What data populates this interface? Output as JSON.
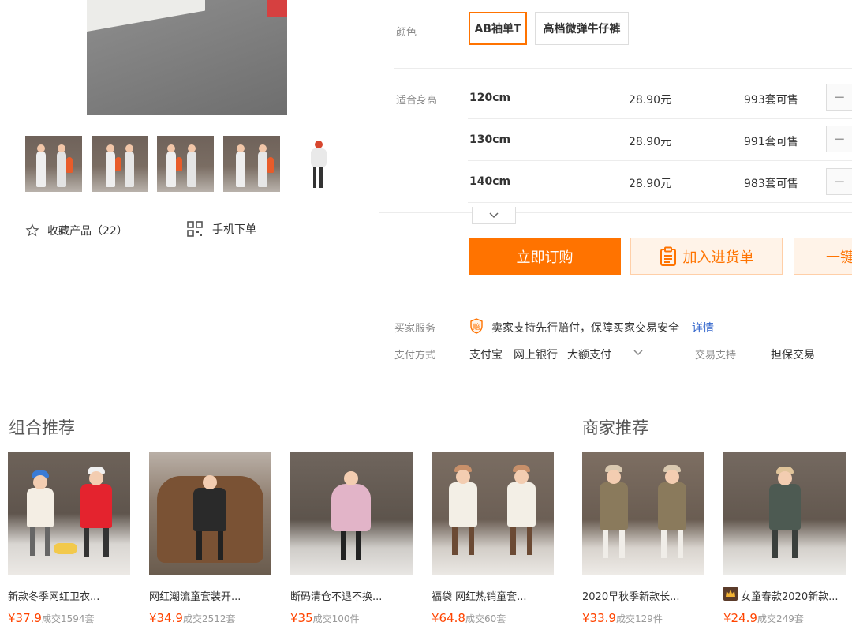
{
  "gallery": {
    "favorite_label": "收藏产品（22）",
    "mobile_order_label": "手机下单"
  },
  "spec": {
    "color_label": "颜色",
    "color_options": [
      "AB袖单T",
      "高档微弹牛仔裤"
    ],
    "selected_color": "AB袖单T",
    "height_label": "适合身高",
    "rows": [
      {
        "size": "120cm",
        "price": "28.90元",
        "stock": "993套可售"
      },
      {
        "size": "130cm",
        "price": "28.90元",
        "stock": "991套可售"
      },
      {
        "size": "140cm",
        "price": "28.90元",
        "stock": "983套可售"
      }
    ],
    "minus_symbol": "−"
  },
  "actions": {
    "buy_label": "立即订购",
    "cart_label": "加入进货单",
    "one_label": "一键"
  },
  "service": {
    "buyer_service_label": "买家服务",
    "buyer_service_text": "卖家支持先行赔付，保障买家交易安全",
    "detail_link": "详情",
    "payment_label": "支付方式",
    "payment_methods": [
      "支付宝",
      "网上银行",
      "大额支付"
    ],
    "trade_support_label": "交易支持",
    "trade_support_value": "担保交易"
  },
  "combo": {
    "title": "组合推荐",
    "items": [
      {
        "name": "新款冬季网红卫衣...",
        "price": "¥37.9",
        "sold": "成交1594套"
      },
      {
        "name": "网红潮流童套装开...",
        "price": "¥34.9",
        "sold": "成交2512套"
      },
      {
        "name": "断码清仓不退不换...",
        "price": "¥35",
        "sold": "成交100件"
      },
      {
        "name": "福袋 网红热销童套...",
        "price": "¥64.8",
        "sold": "成交60套"
      }
    ]
  },
  "merchant": {
    "title": "商家推荐",
    "items": [
      {
        "name": "2020早秋季新款长...",
        "price": "¥33.9",
        "sold": "成交129件"
      },
      {
        "name": "女童春款2020新款...",
        "price": "¥24.9",
        "sold": "成交249套"
      }
    ]
  },
  "colors": {
    "accent": "#ff7300",
    "price": "#ff4400",
    "link": "#3366cc"
  }
}
